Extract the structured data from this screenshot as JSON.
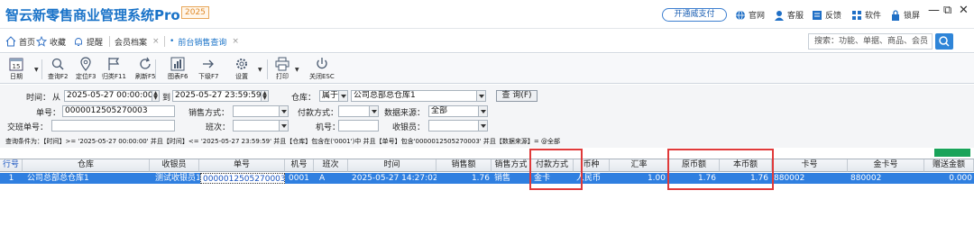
{
  "app": {
    "title": "智云新零售商业管理系统Pro",
    "year_badge": "2025",
    "pay_button": "开通威支付",
    "links": [
      "官网",
      "客服",
      "反馈",
      "软件",
      "锁屏"
    ],
    "window_controls": [
      "—",
      "⧉",
      "✕"
    ]
  },
  "tabs": {
    "home": "首页",
    "favorites": "收藏",
    "reminder": "提醒",
    "items": [
      {
        "label": "会员档案",
        "active": false
      },
      {
        "label": "前台销售查询",
        "active": true
      }
    ],
    "close_glyph": "×",
    "search_placeholder": "搜索：功能、单据、商品、会员"
  },
  "toolbar": [
    {
      "label": "日期",
      "icon": "calendar-icon",
      "badge": "15"
    },
    {
      "label": "查询F2",
      "icon": "search-icon"
    },
    {
      "label": "定位F3",
      "icon": "location-icon"
    },
    {
      "label": "归类F11",
      "icon": "flag-icon"
    },
    {
      "label": "刷新F5",
      "icon": "refresh-icon"
    },
    {
      "label": "图表F6",
      "icon": "chart-icon"
    },
    {
      "label": "下级F7",
      "icon": "arrow-right-icon"
    },
    {
      "label": "设置",
      "icon": "gear-icon"
    },
    {
      "label": "打印",
      "icon": "printer-icon"
    },
    {
      "label": "关闭ESC",
      "icon": "power-icon"
    }
  ],
  "filters": {
    "time_label": "时间：",
    "from_label": "从",
    "time_from": "2025-05-27 00:00:00",
    "to_label": "到",
    "time_to": "2025-05-27 23:59:59",
    "warehouse_label": "仓库：",
    "warehouse_op": "属于",
    "warehouse_value": "公司总部总仓库1",
    "query_button": "查 询(F)",
    "order_no_label": "单号：",
    "order_no": "0000012505270003",
    "sale_mode_label": "销售方式：",
    "sale_mode": "",
    "payment_label": "付款方式：",
    "payment": "",
    "data_source_label": "数据来源：",
    "data_source": "全部",
    "exchange_no_label": "交班单号：",
    "exchange_no": "",
    "shift_label": "班次：",
    "shift": "",
    "machine_label": "机号：",
    "machine": "",
    "cashier_label": "收银员：",
    "cashier": ""
  },
  "condition_text": "查询条件为：【时间】>= '2025-05-27 00:00:00' 并且【时间】<= '2025-05-27 23:59:59' 并且【仓库】包含在('0001')中 并且【单号】包含'0000012505270003' 并且【数据来源】= @全部",
  "grid": {
    "columns": [
      "行号",
      "仓库",
      "收银员",
      "单号",
      "机号",
      "班次",
      "时间",
      "销售额",
      "销售方式",
      "付款方式",
      "币种",
      "汇率",
      "原币额",
      "本币额",
      "卡号",
      "金卡号",
      "赠送金额"
    ],
    "rows": [
      [
        "1",
        "公司总部总仓库1",
        "测试收银员1",
        "0000012505270003",
        "0001",
        "A",
        "2025-05-27 14:27:02",
        "1.76",
        "销售",
        "金卡",
        "人民币",
        "1.00",
        "1.76",
        "1.76",
        "880002",
        "880002",
        "0.000"
      ]
    ]
  },
  "colors": {
    "accent": "#1a73c8",
    "selected_row": "#2f7fe0",
    "highlight_box": "#e03a3a",
    "status_green": "#19a35a"
  }
}
